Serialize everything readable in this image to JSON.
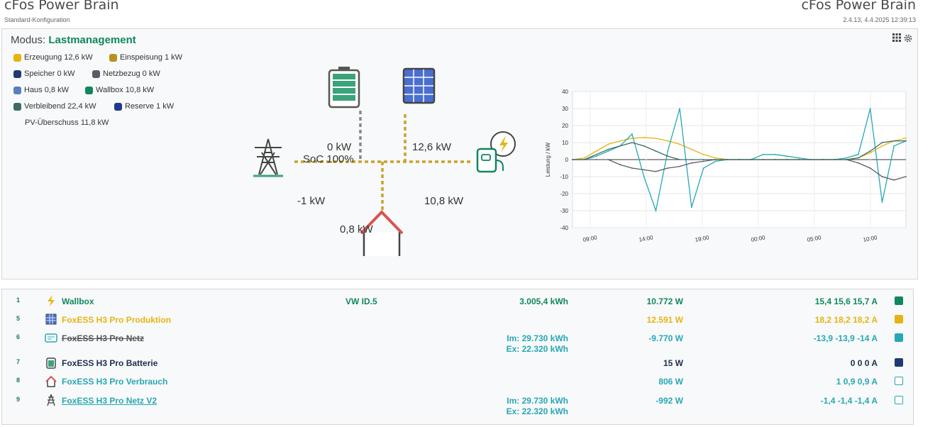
{
  "header": {
    "title_left": "cFos Power Brain",
    "subtitle_left": "Standard-Konfiguration",
    "title_right": "cFos Power Brain",
    "subtitle_right": "2.4.13, 4.4.2025 12:39:13"
  },
  "mode": {
    "label": "Modus:",
    "value": "Lastmanagement"
  },
  "legend": [
    {
      "label": "Erzeugung 12,6 kW",
      "color": "#e6b411"
    },
    {
      "label": "Einspeisung 1 kW",
      "color": "#b8931c"
    },
    {
      "label": "Speicher 0 kW",
      "color": "#1f3a72"
    },
    {
      "label": "Netzbezug 0 kW",
      "color": "#5c5c66"
    },
    {
      "label": "Haus 0,8 kW",
      "color": "#5a7fc0"
    },
    {
      "label": "Wallbox 10,8 kW",
      "color": "#11875d"
    },
    {
      "label": "Verbleibend 22,4 kW",
      "color": "#3d6b63"
    },
    {
      "label": "Reserve 1 kW",
      "color": "#1f3a8a"
    }
  ],
  "pv_surplus": "PV-Überschuss 11,8 kW",
  "panel_icons": [
    "grid-icon",
    "gear-icon"
  ],
  "flow": {
    "battery_kw": "0 kW",
    "battery_soc": "SoC 100%",
    "solar_kw": "12,6 kW",
    "grid_kw": "-1 kW",
    "wallbox_kw": "10,8 kW",
    "house_kw": "0,8 kW"
  },
  "chart_data": {
    "type": "line",
    "ylabel": "Leistung / kW",
    "ylim": [
      -40,
      40
    ],
    "yticks": [
      "40",
      "30",
      "20",
      "10",
      "0",
      "-10",
      "-20",
      "-30",
      "-40"
    ],
    "xticks": [
      "09:00",
      "14:00",
      "19:00",
      "00:00",
      "05:00",
      "10:00"
    ],
    "grid": true,
    "x": [
      0,
      1,
      2,
      3,
      4,
      5,
      6,
      7,
      8,
      9,
      10,
      11,
      12,
      13,
      14,
      15,
      16,
      17,
      18,
      19,
      20,
      21,
      22,
      23,
      24,
      25,
      26,
      27,
      28
    ],
    "series": [
      {
        "color": "#e6b411",
        "values": [
          0,
          1,
          5,
          9,
          11,
          12.5,
          13,
          12.5,
          11,
          9,
          6,
          3,
          1,
          0,
          0,
          0,
          0,
          0,
          0,
          0,
          0,
          0,
          0,
          0,
          1,
          4,
          8,
          11,
          12.6
        ]
      },
      {
        "color": "#26a8b5",
        "values": [
          0,
          0,
          2,
          5,
          8,
          15,
          -10,
          -30,
          5,
          30,
          -28,
          -5,
          -1,
          0,
          0,
          0,
          3,
          3,
          2,
          1,
          0,
          0,
          0,
          1,
          3,
          30,
          -25,
          8,
          11
        ]
      },
      {
        "color": "#5c5c66",
        "values": [
          0,
          0,
          0,
          0,
          -3,
          -5,
          -6,
          -7,
          -5,
          -4,
          -2,
          -1,
          0,
          0,
          0,
          0,
          0,
          0,
          0,
          0,
          0,
          0,
          0,
          0,
          -2,
          -5,
          -10,
          -12,
          -10
        ]
      },
      {
        "color": "#3d6b63",
        "values": [
          0,
          0,
          3,
          6,
          8,
          10,
          8,
          5,
          2,
          0,
          0,
          0,
          0,
          0,
          0,
          0,
          0,
          0,
          0,
          0,
          0,
          0,
          0,
          0,
          1,
          5,
          10,
          11,
          11
        ]
      }
    ]
  },
  "table": [
    {
      "num": "1",
      "icon": "lightning-icon",
      "name": "Wallbox",
      "name_color": "#11875d",
      "car": "VW ID.5",
      "kwh_a": "3.005,4 kWh",
      "kwh_b": "",
      "w": "10.772 W",
      "a": "15,4 15,6 15,7 A",
      "color": "#11875d",
      "square": "filled",
      "val_color": "#11875d"
    },
    {
      "num": "5",
      "icon": "solar-panel-icon",
      "name": "FoxESS H3 Pro Produktion",
      "name_color": "#e6b411",
      "car": "",
      "kwh_a": "",
      "kwh_b": "",
      "w": "12.591 W",
      "a": "18,2 18,2 18,2 A",
      "color": "#e6b411",
      "square": "filled",
      "val_color": "#e6b411"
    },
    {
      "num": "6",
      "icon": "meter-icon",
      "name": "FoxESS H3 Pro Netz",
      "name_color": "#555555",
      "car": "",
      "kwh_a": "Im: 29.730 kWh",
      "kwh_b": "Ex: 22.320 kWh",
      "w": "-9.770 W",
      "a": "-13,9 -13,9 -14 A",
      "color": "#26a8b5",
      "square": "filled",
      "val_color": "#26a8b5"
    },
    {
      "num": "7",
      "icon": "battery-icon",
      "name": "FoxESS H3 Pro Batterie",
      "name_color": "#1f2d4d",
      "car": "",
      "kwh_a": "",
      "kwh_b": "",
      "w": "15 W",
      "a": "0 0 0 A",
      "color": "#1f3a72",
      "square": "filled",
      "val_color": "#1f2d4d"
    },
    {
      "num": "8",
      "icon": "house-icon",
      "name": "FoxESS H3 Pro Verbrauch",
      "name_color": "#26a8b5",
      "car": "",
      "kwh_a": "",
      "kwh_b": "",
      "w": "806 W",
      "a": "1 0,9 0,9 A",
      "color": "#26a8b5",
      "square": "outline",
      "val_color": "#26a8b5"
    },
    {
      "num": "9",
      "icon": "power-pylon-icon",
      "name": "FoxESS H3 Pro Netz V2",
      "name_color": "#26a8b5",
      "car": "",
      "kwh_a": "Im: 29.730 kWh",
      "kwh_b": "Ex: 22.320 kWh",
      "w": "-992 W",
      "a": "-1,4 -1,4 -1,4 A",
      "color": "#26a8b5",
      "square": "outline",
      "val_color": "#26a8b5"
    }
  ]
}
